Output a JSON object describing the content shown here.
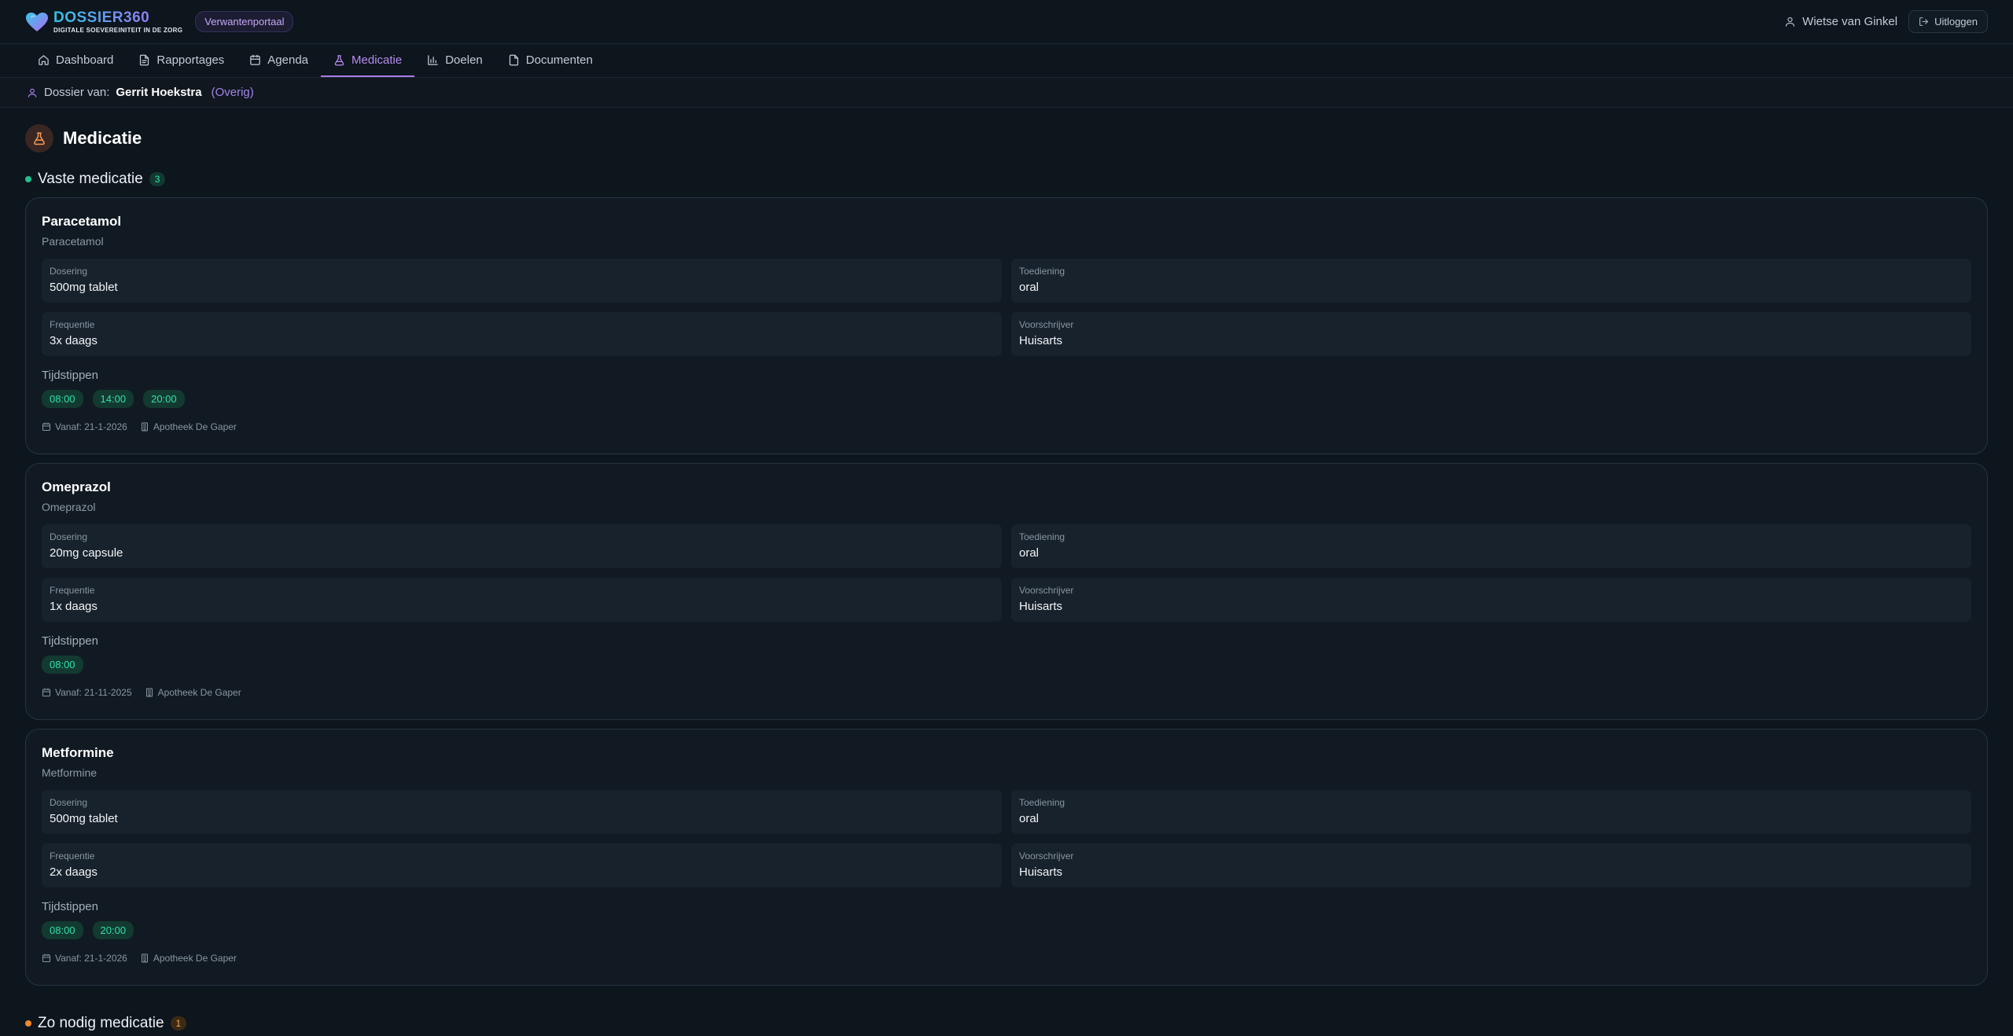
{
  "header": {
    "brand_title": "DOSSIER360",
    "brand_subtitle": "DIGITALE SOEVEREINITEIT IN DE ZORG",
    "portal_badge": "Verwantenportaal",
    "user_name": "Wietse van Ginkel",
    "logout_label": "Uitloggen"
  },
  "nav": {
    "items": [
      {
        "label": "Dashboard",
        "icon": "home-icon"
      },
      {
        "label": "Rapportages",
        "icon": "file-text-icon"
      },
      {
        "label": "Agenda",
        "icon": "calendar-icon"
      },
      {
        "label": "Medicatie",
        "icon": "flask-icon",
        "active": true
      },
      {
        "label": "Doelen",
        "icon": "bar-chart-icon"
      },
      {
        "label": "Documenten",
        "icon": "file-icon"
      }
    ]
  },
  "dossier": {
    "prefix": "Dossier van:",
    "name": "Gerrit Hoekstra",
    "relation": "(Overig)"
  },
  "page": {
    "title": "Medicatie"
  },
  "sections": {
    "fixed": {
      "title": "Vaste medicatie",
      "count": "3"
    },
    "as_needed": {
      "title": "Zo nodig medicatie",
      "count": "1"
    }
  },
  "labels": {
    "dosage": "Dosering",
    "administration": "Toediening",
    "frequency": "Frequentie",
    "prescriber": "Voorschrijver",
    "times": "Tijdstippen"
  },
  "medications": [
    {
      "name": "Paracetamol",
      "generic": "Paracetamol",
      "dosage": "500mg tablet",
      "administration": "oral",
      "frequency": "3x daags",
      "prescriber": "Huisarts",
      "times": [
        "08:00",
        "14:00",
        "20:00"
      ],
      "from": "Vanaf: 21-1-2026",
      "pharmacy": "Apotheek De Gaper"
    },
    {
      "name": "Omeprazol",
      "generic": "Omeprazol",
      "dosage": "20mg capsule",
      "administration": "oral",
      "frequency": "1x daags",
      "prescriber": "Huisarts",
      "times": [
        "08:00"
      ],
      "from": "Vanaf: 21-11-2025",
      "pharmacy": "Apotheek De Gaper"
    },
    {
      "name": "Metformine",
      "generic": "Metformine",
      "dosage": "500mg tablet",
      "administration": "oral",
      "frequency": "2x daags",
      "prescriber": "Huisarts",
      "times": [
        "08:00",
        "20:00"
      ],
      "from": "Vanaf: 21-1-2026",
      "pharmacy": "Apotheek De Gaper"
    }
  ],
  "colors": {
    "accent": "#a97bea",
    "brand_cyan": "#2fc6e6",
    "success": "#1ec28f",
    "warning": "#f08a2d",
    "background": "#0d151d"
  }
}
